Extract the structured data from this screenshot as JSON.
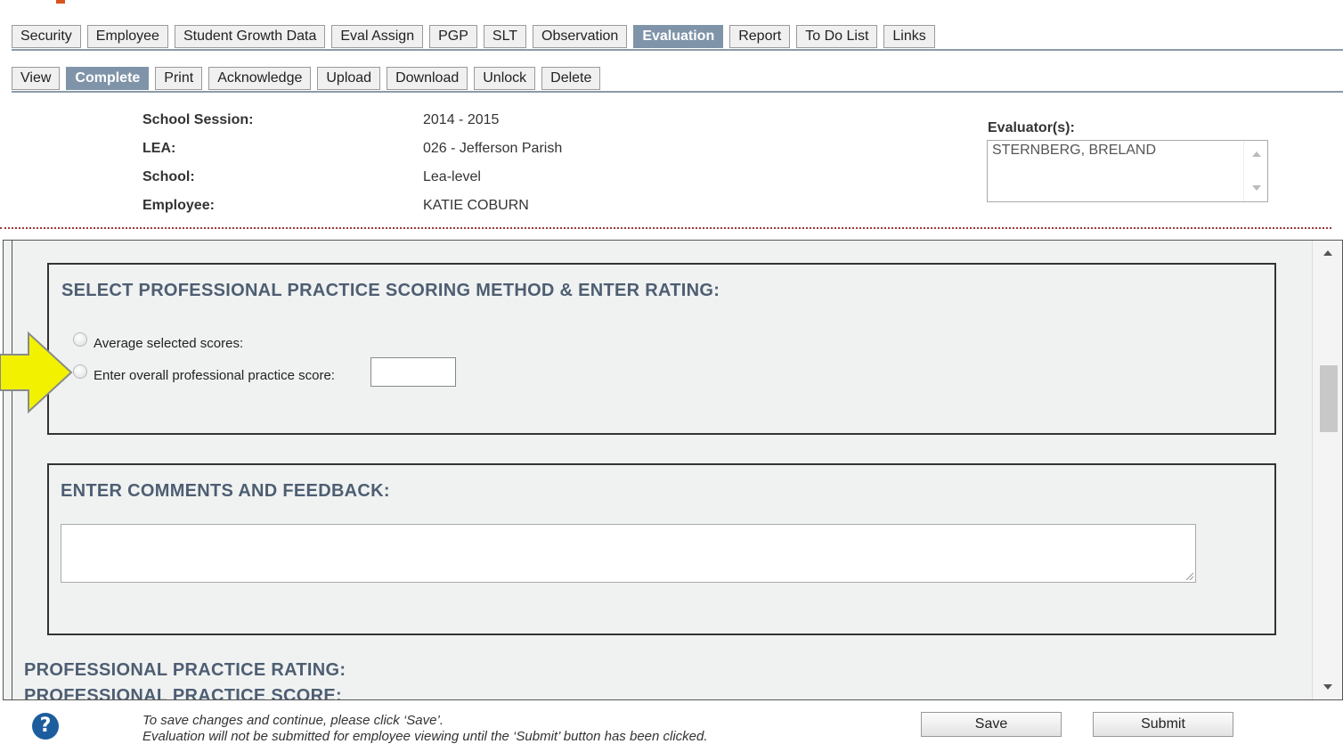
{
  "main_tabs": [
    {
      "label": "Security",
      "active": false
    },
    {
      "label": "Employee",
      "active": false
    },
    {
      "label": "Student Growth Data",
      "active": false
    },
    {
      "label": "Eval Assign",
      "active": false
    },
    {
      "label": "PGP",
      "active": false
    },
    {
      "label": "SLT",
      "active": false
    },
    {
      "label": "Observation",
      "active": false
    },
    {
      "label": "Evaluation",
      "active": true
    },
    {
      "label": "Report",
      "active": false
    },
    {
      "label": "To Do List",
      "active": false
    },
    {
      "label": "Links",
      "active": false
    }
  ],
  "sub_tabs": [
    {
      "label": "View",
      "active": false
    },
    {
      "label": "Complete",
      "active": true
    },
    {
      "label": "Print",
      "active": false
    },
    {
      "label": "Acknowledge",
      "active": false
    },
    {
      "label": "Upload",
      "active": false
    },
    {
      "label": "Download",
      "active": false
    },
    {
      "label": "Unlock",
      "active": false
    },
    {
      "label": "Delete",
      "active": false
    }
  ],
  "header": {
    "session_label": "School Session:",
    "session_value": "2014 - 2015",
    "lea_label": "LEA:",
    "lea_value": "026 - Jefferson Parish",
    "school_label": "School:",
    "school_value": "Lea-level",
    "employee_label": "Employee:",
    "employee_value": "KATIE COBURN",
    "evaluators_label": "Evaluator(s):",
    "evaluators_value": "STERNBERG, BRELAND"
  },
  "scoring": {
    "title": "SELECT PROFESSIONAL PRACTICE SCORING METHOD & ENTER RATING:",
    "option_average": "Average selected scores:",
    "option_overall": "Enter overall professional practice score:",
    "overall_value": ""
  },
  "comments": {
    "title": "ENTER COMMENTS AND FEEDBACK:",
    "value": ""
  },
  "rating": {
    "title": "PROFESSIONAL PRACTICE RATING:",
    "score_title": "PROFESSIONAL PRACTICE SCORE:"
  },
  "footer": {
    "help_glyph": "?",
    "line1": "To save changes and continue, please click ‘Save’.",
    "line2": "Evaluation will not be submitted for employee viewing until the ‘Submit’ button has been clicked.",
    "save_label": "Save",
    "submit_label": "Submit"
  },
  "colors": {
    "active_tab": "#7f94a8",
    "section_title": "#4e5e72",
    "arrow_fill": "#f2f200",
    "help_icon": "#1d5d9e"
  }
}
